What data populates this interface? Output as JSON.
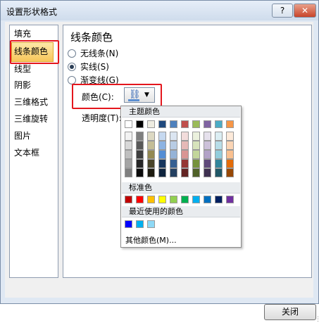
{
  "title": "设置形状格式",
  "titlebar": {
    "help_label": "?",
    "close_label": "✕"
  },
  "nav": {
    "items": [
      {
        "label": "填充"
      },
      {
        "label": "线条颜色"
      },
      {
        "label": "线型"
      },
      {
        "label": "阴影"
      },
      {
        "label": "三维格式"
      },
      {
        "label": "三维旋转"
      },
      {
        "label": "图片"
      },
      {
        "label": "文本框"
      }
    ],
    "selected_index": 1
  },
  "panel": {
    "title": "线条颜色",
    "radios": [
      {
        "label": "无线条(N)",
        "checked": false
      },
      {
        "label": "实线(S)",
        "checked": true
      },
      {
        "label": "渐变线(G)",
        "checked": false
      }
    ],
    "color_label": "颜色(C):",
    "color_button_icon": "paint-bucket-icon",
    "transparency_label": "透明度(T):"
  },
  "color_popup": {
    "theme_header": "主题颜色",
    "theme_top": [
      "#ffffff",
      "#000000",
      "#eeece1",
      "#1f497d",
      "#4f81bd",
      "#c0504d",
      "#9bbb59",
      "#8064a2",
      "#4bacc6",
      "#f79646"
    ],
    "theme_shades": [
      [
        "#f2f2f2",
        "#d8d8d8",
        "#bfbfbf",
        "#a5a5a5",
        "#7f7f7f"
      ],
      [
        "#7f7f7f",
        "#595959",
        "#3f3f3f",
        "#262626",
        "#0c0c0c"
      ],
      [
        "#ddd9c3",
        "#c4bd97",
        "#938953",
        "#494429",
        "#1d1b10"
      ],
      [
        "#c6d9f0",
        "#8db3e2",
        "#548dd4",
        "#17365d",
        "#0f243e"
      ],
      [
        "#dbe5f1",
        "#b8cce4",
        "#95b3d7",
        "#366092",
        "#244061"
      ],
      [
        "#f2dcdb",
        "#e5b9b7",
        "#d99694",
        "#953734",
        "#632423"
      ],
      [
        "#ebf1dd",
        "#d7e3bc",
        "#c3d69b",
        "#76923c",
        "#4f6128"
      ],
      [
        "#e5e0ec",
        "#ccc1d9",
        "#b2a2c7",
        "#5f497a",
        "#3f3151"
      ],
      [
        "#dbeef3",
        "#b7dde8",
        "#92cddc",
        "#31859b",
        "#205867"
      ],
      [
        "#fdeada",
        "#fbd5b5",
        "#fac08f",
        "#e36c09",
        "#974806"
      ]
    ],
    "standard_header": "标准色",
    "standard": [
      "#c00000",
      "#ff0000",
      "#ffc000",
      "#ffff00",
      "#92d050",
      "#00b050",
      "#00b0f0",
      "#0070c0",
      "#002060",
      "#7030a0"
    ],
    "recent_header": "最近使用的颜色",
    "recent": [
      "#0000ff",
      "#00b0f0",
      "#8ed9f6"
    ],
    "more_label": "其他颜色(M)..."
  },
  "close_button": "关闭"
}
